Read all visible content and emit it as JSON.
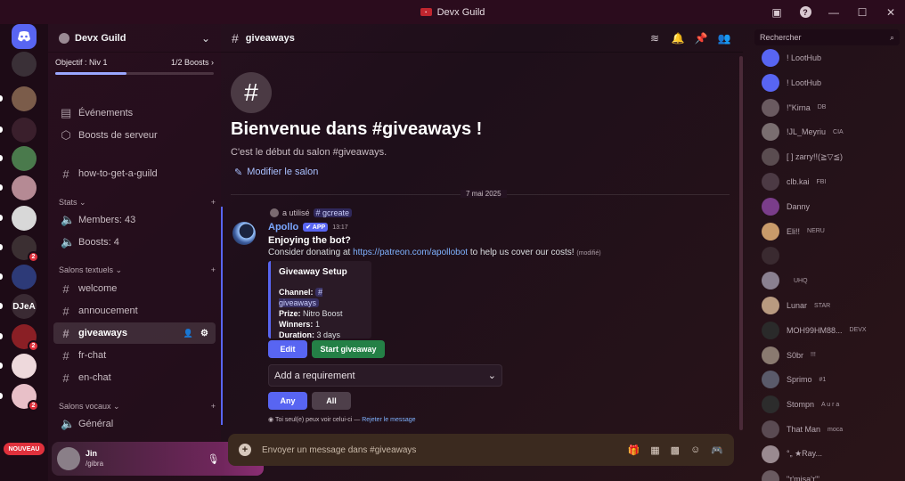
{
  "window": {
    "title": "Devx Guild"
  },
  "rail": {
    "servers": [
      {
        "label": "",
        "color": "#5865f2",
        "badge": ""
      },
      {
        "label": "",
        "color": "#3a3037",
        "badge": ""
      },
      {
        "label": "",
        "color": "#7b5c4a",
        "badge": ""
      },
      {
        "label": "",
        "color": "#3a1f2c",
        "badge": ""
      },
      {
        "label": "",
        "color": "#4a7a4c",
        "badge": ""
      },
      {
        "label": "",
        "color": "#b58a94",
        "badge": ""
      },
      {
        "label": "",
        "color": "#d8d8d8",
        "badge": ""
      },
      {
        "label": "",
        "color": "#3b2f32",
        "badge": "2"
      },
      {
        "label": "",
        "color": "#2d3a78",
        "badge": ""
      },
      {
        "label": "DJeA",
        "color": "#3a2a33",
        "badge": ""
      },
      {
        "label": "",
        "color": "#8a1f25",
        "badge": "2"
      },
      {
        "label": "",
        "color": "#eed9dc",
        "badge": ""
      },
      {
        "label": "",
        "color": "#e8c0c8",
        "badge": "2"
      }
    ],
    "nouveau": "NOUVEAU"
  },
  "sidebar": {
    "guild": "Devx Guild",
    "goal_label": "Objectif : Niv 1",
    "goal_boosts": "1/2 Boosts",
    "goal_progress": 0.45,
    "events": "Événements",
    "boosts": "Boosts de serveur",
    "guide_channel": "how-to-get-a-guild",
    "cat_stats": "Stats",
    "members_stat": "Members: 43",
    "boosts_stat": "Boosts: 4",
    "cat_text": "Salons textuels",
    "channels": [
      "welcome",
      "annoucement",
      "giveaways",
      "fr-chat",
      "en-chat"
    ],
    "cat_voice": "Salons vocaux",
    "voice": "Général"
  },
  "user": {
    "name": "Jin",
    "status": "/gibra"
  },
  "header": {
    "channel": "giveaways"
  },
  "welcome": {
    "title": "Bienvenue dans #giveaways !",
    "subtitle": "C'est le début du salon #giveaways.",
    "edit": "Modifier le salon"
  },
  "date_divider": "7 mai 2025",
  "message": {
    "used_text": "a utilisé",
    "command": "# gcreate",
    "author": "Apollo",
    "app_tag": "APP",
    "time": "13:17",
    "line1": "Enjoying the bot?",
    "line2_pre": "Consider donating at",
    "link": "https://patreon.com/apollobot",
    "line2_post": "to help us cover our costs!",
    "edited": "(modifié)",
    "embed": {
      "title": "Giveaway Setup",
      "channel_label": "Channel:",
      "channel_value": "# giveaways",
      "prize_label": "Prize:",
      "prize_value": "Nitro Boost",
      "winners_label": "Winners:",
      "winners_value": "1",
      "duration_label": "Duration:",
      "duration_value": "3 days"
    },
    "btn_edit": "Edit",
    "btn_start": "Start giveaway",
    "select": "Add a requirement",
    "btn_any": "Any",
    "btn_all": "All",
    "note": "Toi seul(e) peux voir celui-ci —",
    "dismiss": "Rejeter le message"
  },
  "composer": {
    "placeholder": "Envoyer un message dans #giveaways"
  },
  "members": {
    "search": "Rechercher",
    "list": [
      {
        "name": "! LootHub",
        "tag": "",
        "color": "#5865f2"
      },
      {
        "name": "! LootHub",
        "tag": "",
        "color": "#5865f2"
      },
      {
        "name": "!\"Kirna",
        "tag": "DB",
        "color": "#6a5a60"
      },
      {
        "name": "!JL_Meyriu",
        "tag": "CIA",
        "color": "#7a6e70"
      },
      {
        "name": "[ ] zarry!!(≧▽≦)",
        "tag": "",
        "color": "#5a4c50"
      },
      {
        "name": "clb.kai",
        "tag": "FBI",
        "color": "#4c3a44"
      },
      {
        "name": "Danny",
        "tag": "",
        "color": "#7a3d8a"
      },
      {
        "name": "Eli!!",
        "tag": "NERU",
        "color": "#c99a6a"
      },
      {
        "name": "",
        "tag": "",
        "color": "#3a2a30"
      },
      {
        "name": "",
        "tag": "UHQ",
        "color": "#8a8090"
      },
      {
        "name": "Lunar",
        "tag": "STAR",
        "color": "#b89a80"
      },
      {
        "name": "MOH99HM88...",
        "tag": "DEVX",
        "color": "#2a2a2a"
      },
      {
        "name": "S0br",
        "tag": "!!!",
        "color": "#8a7a70"
      },
      {
        "name": "Sprimo",
        "tag": "#1",
        "color": "#5a5a6a"
      },
      {
        "name": "Stompn",
        "tag": "A u r a",
        "color": "#2c2c2c"
      },
      {
        "name": "That Man",
        "tag": "moca",
        "color": "#5a4a52"
      },
      {
        "name": "°„ ★Ray...",
        "tag": "",
        "color": "#9a8a90"
      },
      {
        "name": "\"ɪ'misa'ɪ'\"",
        "tag": "",
        "color": "#6a5a60"
      }
    ]
  }
}
